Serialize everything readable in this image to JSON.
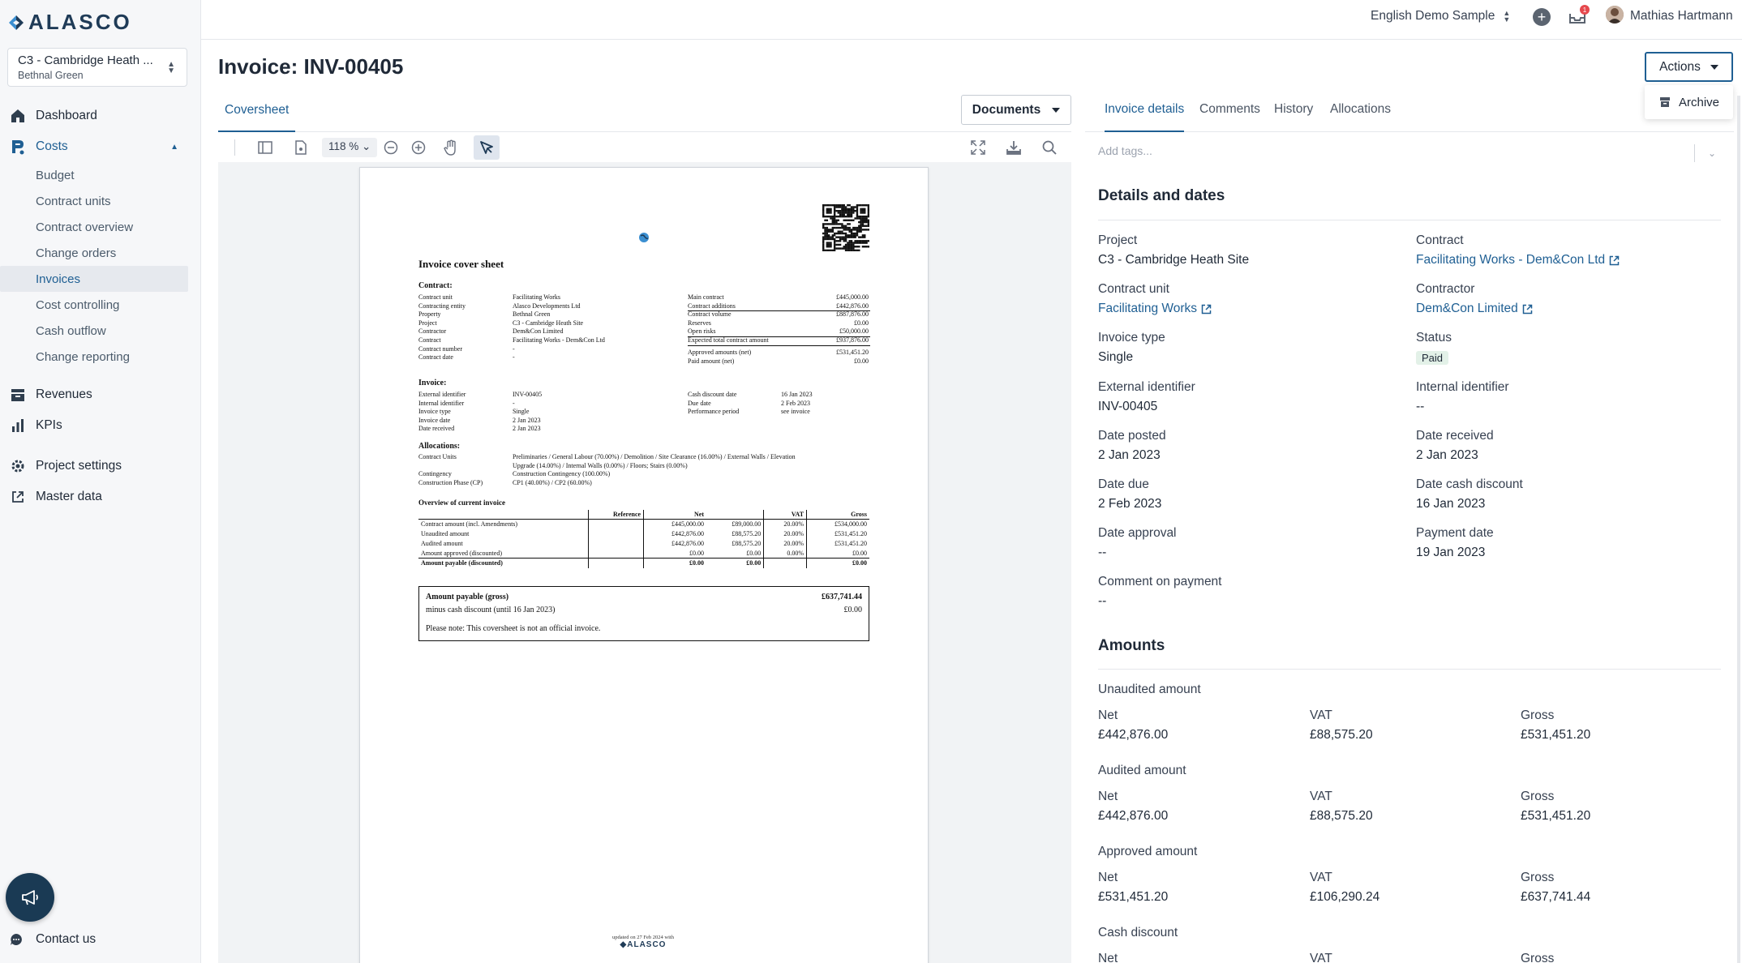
{
  "brand": {
    "logo_text": "ALASCO"
  },
  "project_selector": {
    "name": "C3 - Cambridge Heath ...",
    "location": "Bethnal Green"
  },
  "sidebar": {
    "dashboard": "Dashboard",
    "costs": "Costs",
    "cost_items": [
      "Budget",
      "Contract units",
      "Contract overview",
      "Change orders",
      "Invoices",
      "Cost controlling",
      "Cash outflow",
      "Change reporting"
    ],
    "revenues": "Revenues",
    "kpis": "KPIs",
    "project_settings": "Project settings",
    "master_data": "Master data",
    "contact": "Contact us"
  },
  "topbar": {
    "workspace": "English Demo Sample",
    "notifications_count": "1",
    "user_name": "Mathias Hartmann"
  },
  "page": {
    "title": "Invoice: INV-00405",
    "actions_label": "Actions",
    "archive_label": "Archive"
  },
  "left_panel": {
    "tab": "Coversheet",
    "documents_label": "Documents",
    "zoom": "118 %"
  },
  "document": {
    "heading": "Invoice cover sheet",
    "contract_heading": "Contract:",
    "contract_rows": [
      {
        "label": "Contract unit",
        "value": "Facilitating Works"
      },
      {
        "label": "Contracting entity",
        "value": "Alasco Developments Ltd"
      },
      {
        "label": "Property",
        "value": "Bethnal Green"
      },
      {
        "label": "Project",
        "value": "C3 - Cambridge Heath Site"
      },
      {
        "label": "Contractor",
        "value": "Dem&Con Limited"
      },
      {
        "label": "Contract",
        "value": "Facilitating Works - Dem&Con Ltd"
      },
      {
        "label": "Contract number",
        "value": "-"
      },
      {
        "label": "Contract date",
        "value": "-"
      }
    ],
    "contract_amounts": [
      {
        "label": "Main contract",
        "value": "£445,000.00"
      },
      {
        "label": "Contract additions",
        "value": "£442,876.00"
      },
      {
        "label": "Contract volume",
        "value": "£887,876.00"
      },
      {
        "label": "Reserves",
        "value": "£0.00"
      },
      {
        "label": "Open risks",
        "value": "£50,000.00"
      },
      {
        "label": "Expected total contract amount",
        "value": "£937,876.00"
      },
      {
        "label": "Approved amounts (net)",
        "value": "£531,451.20"
      },
      {
        "label": "Paid amount (net)",
        "value": "£0.00"
      }
    ],
    "invoice_heading": "Invoice:",
    "invoice_rows": [
      {
        "label": "External identifier",
        "value": "INV-00405"
      },
      {
        "label": "Internal identifier",
        "value": "-"
      },
      {
        "label": "Invoice type",
        "value": "Single"
      },
      {
        "label": "Invoice date",
        "value": "2 Jan 2023"
      },
      {
        "label": "Date received",
        "value": "2 Jan 2023"
      }
    ],
    "invoice_dates": [
      {
        "label": "Cash discount date",
        "value": "16 Jan 2023"
      },
      {
        "label": "Due date",
        "value": "2 Feb 2023"
      },
      {
        "label": "Performance period",
        "value": "see invoice"
      }
    ],
    "allocations_heading": "Allocations:",
    "allocations": [
      {
        "label": "Contract Units",
        "value": "Preliminaries / General Labour (70.00%) / Demolition / Site Clearance (16.00%) / External Walls / Elevation"
      },
      {
        "label": "",
        "value": "Upgrade (14.00%) / Internal Walls (0.00%) / Floors; Stairs (0.00%)"
      },
      {
        "label": "Contingency",
        "value": "Construction Contingency (100.00%)"
      },
      {
        "label": "Construction Phase (CP)",
        "value": "CP1 (40.00%) / CP2 (60.00%)"
      }
    ],
    "overview_heading": "Overview of current invoice",
    "overview_headers": [
      "",
      "Reference",
      "Net",
      "",
      "VAT",
      "Gross"
    ],
    "overview_rows": [
      [
        "Contract amount (incl. Amendments)",
        "",
        "£445,000.00",
        "£89,000.00",
        "20.00%",
        "£534,000.00"
      ],
      [
        "Unaudited amount",
        "",
        "£442,876.00",
        "£88,575.20",
        "20.00%",
        "£531,451.20"
      ],
      [
        "Audited amount",
        "",
        "£442,876.00",
        "£88,575.20",
        "20.00%",
        "£531,451.20"
      ],
      [
        "Amount approved (discounted)",
        "",
        "£0.00",
        "£0.00",
        "0.00%",
        "£0.00"
      ]
    ],
    "overview_total": [
      "Amount payable (discounted)",
      "",
      "£0.00",
      "£0.00",
      "",
      "£0.00"
    ],
    "payable": {
      "gross_label": "Amount payable (gross)",
      "gross_value": "£637,741.44",
      "discount_label": "minus cash discount (until 16 Jan 2023)",
      "discount_value": "£0.00",
      "note": "Please note: This coversheet is not an official invoice."
    },
    "footer_updated": "updated on 27 Feb 2024 with",
    "footer_brand": "ALASCO"
  },
  "right_panel": {
    "tabs": [
      "Invoice details",
      "Comments",
      "History",
      "Allocations"
    ],
    "tags_placeholder": "Add tags...",
    "details_title": "Details and dates",
    "fields": {
      "project": {
        "label": "Project",
        "value": "C3 - Cambridge Heath Site"
      },
      "contract": {
        "label": "Contract",
        "value": "Facilitating Works - Dem&Con Ltd"
      },
      "contract_unit": {
        "label": "Contract unit",
        "value": "Facilitating Works"
      },
      "contractor": {
        "label": "Contractor",
        "value": "Dem&Con Limited"
      },
      "invoice_type": {
        "label": "Invoice type",
        "value": "Single"
      },
      "status": {
        "label": "Status",
        "value": "Paid"
      },
      "external_identifier": {
        "label": "External identifier",
        "value": "INV-00405"
      },
      "internal_identifier": {
        "label": "Internal identifier",
        "value": "--"
      },
      "date_posted": {
        "label": "Date posted",
        "value": "2 Jan 2023"
      },
      "date_received": {
        "label": "Date received",
        "value": "2 Jan 2023"
      },
      "date_due": {
        "label": "Date due",
        "value": "2 Feb 2023"
      },
      "date_cash_discount": {
        "label": "Date cash discount",
        "value": "16 Jan 2023"
      },
      "date_approval": {
        "label": "Date approval",
        "value": "--"
      },
      "payment_date": {
        "label": "Payment date",
        "value": "19 Jan 2023"
      },
      "comment_on_payment": {
        "label": "Comment on payment",
        "value": "--"
      }
    },
    "amounts_title": "Amounts",
    "amount_groups": [
      {
        "title": "Unaudited amount",
        "net": "£442,876.00",
        "vat": "£88,575.20",
        "gross": "£531,451.20"
      },
      {
        "title": "Audited amount",
        "net": "£442,876.00",
        "vat": "£88,575.20",
        "gross": "£531,451.20"
      },
      {
        "title": "Approved amount",
        "net": "£531,451.20",
        "vat": "£106,290.24",
        "gross": "£637,741.44"
      },
      {
        "title": "Cash discount",
        "net": "",
        "vat": "",
        "gross": ""
      }
    ],
    "amount_labels": {
      "net": "Net",
      "vat": "VAT",
      "gross": "Gross"
    }
  },
  "colors": {
    "accent": "#1f5f93",
    "sidebar_bg": "#f6f7f9",
    "paid_badge_bg": "#e3f1e8"
  }
}
